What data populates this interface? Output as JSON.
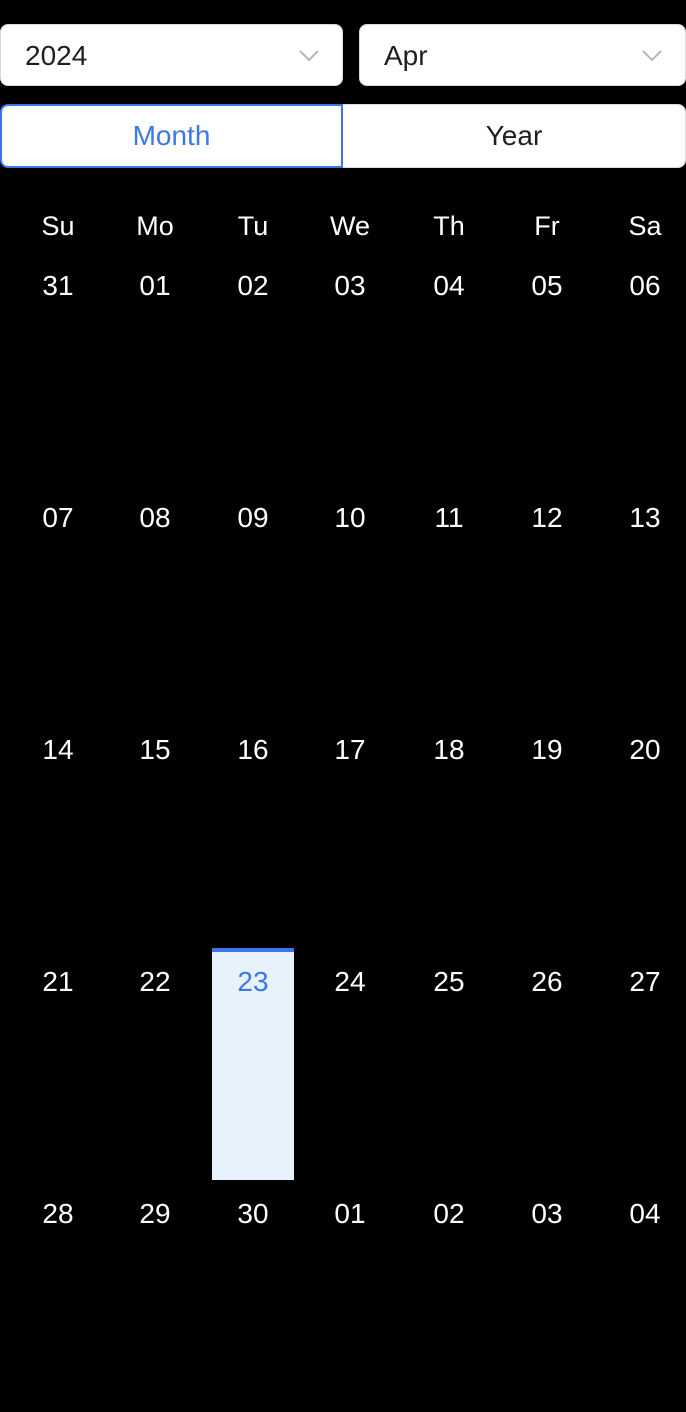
{
  "header": {
    "year_select": {
      "value": "2024",
      "icon": "chevron-down-icon"
    },
    "month_select": {
      "value": "Apr",
      "icon": "chevron-down-icon"
    }
  },
  "mode_switch": {
    "month_label": "Month",
    "year_label": "Year",
    "selected": "Month"
  },
  "calendar": {
    "weekdays": [
      "Su",
      "Mo",
      "Tu",
      "We",
      "Th",
      "Fr",
      "Sa"
    ],
    "weeks": [
      [
        "31",
        "01",
        "02",
        "03",
        "04",
        "05",
        "06"
      ],
      [
        "07",
        "08",
        "09",
        "10",
        "11",
        "12",
        "13"
      ],
      [
        "14",
        "15",
        "16",
        "17",
        "18",
        "19",
        "20"
      ],
      [
        "21",
        "22",
        "23",
        "24",
        "25",
        "26",
        "27"
      ],
      [
        "28",
        "29",
        "30",
        "01",
        "02",
        "03",
        "04"
      ]
    ],
    "selected_date": "23"
  },
  "colors": {
    "accent": "#3b78e7",
    "selected_cell_bg": "#e8f2fd",
    "page_bg": "#000000"
  }
}
